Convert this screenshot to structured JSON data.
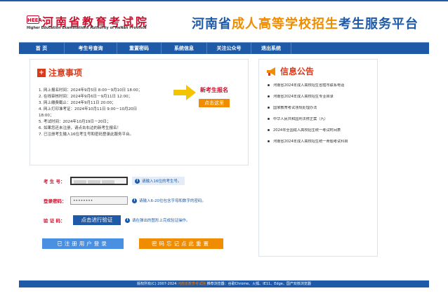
{
  "header": {
    "logo_mark": "HEEA",
    "logo_name": "河南省教育考试院",
    "logo_en": "Higher Education Examinations Authority of HeNan Province",
    "title_part1": "河南省",
    "title_part2": "成人高等学校招生",
    "title_part3": "考生服务平台"
  },
  "nav": {
    "items": [
      "首 页",
      "考生号查询",
      "重置密码",
      "系统信息",
      "关注公众号",
      "退出系统"
    ]
  },
  "notice": {
    "title": "注意事项",
    "items": [
      "1. 网上报名时间：2024年9月5日 8:00－9月10日 18:00；",
      "2. 在线审核时间：2024年9月6日－9月11日 12:00；",
      "3. 网上缴费截止：2024年9月11日 20:00；",
      "4. 网上打印准考证：2024年10月11日 9:00－10月20日",
      "18:00；",
      "5. 考试时间：2024年10月19日－20日；",
      "6. 如果您还未注册，请点击右边的新考生报名！",
      "7. 已注册考生输入16位考生号和密码登录此服务平台。"
    ],
    "cta_title": "新考生报名",
    "cta_button": "点击这里"
  },
  "news": {
    "title": "信息公告",
    "items": [
      "河南省2024年成人高校招生省辖市联系电话",
      "河南省2024年成人高校招生专业目录",
      "国家教育考试违规处理办法",
      "中华人民共和国刑法修正案（九）",
      "2024年全国成人高校招生统一考试时间表",
      "河南省2024年成人高校招生统一命题考试科目"
    ]
  },
  "form": {
    "exam_no_label": "考 生 号：",
    "exam_no_value": "",
    "exam_no_hint": "请输入16位的考生号。",
    "password_label": "登录密码：",
    "password_value": "••••••••",
    "password_hint": "请输入6-20位包含字母和数字的密码。",
    "verify_label": "验 证 码：",
    "verify_button": "点击进行验证",
    "verify_hint": "请在弹出的图形上完成验证操作。",
    "login_button": "已注册用户登录",
    "reset_button": "密码忘记点此重置"
  },
  "footer": {
    "copyright": "版权所有(C) 2007-2024",
    "org_link": "河南省教育考试院",
    "browsers": "推荐浏览器：谷歌Chrome、火狐、IE11、Edge、国产双核浏览器"
  },
  "colors": {
    "brand_blue": "#1e5aa8",
    "brand_red": "#c8102e",
    "accent_orange": "#f08c00"
  }
}
